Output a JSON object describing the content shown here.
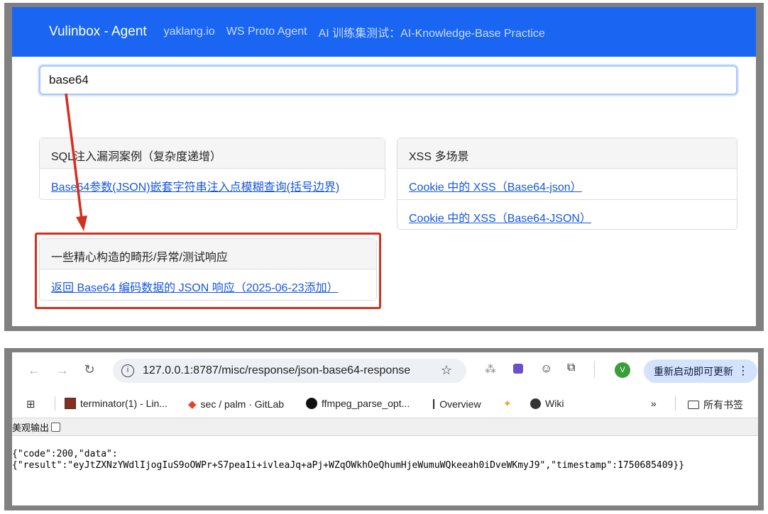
{
  "top": {
    "nav": {
      "brand": "Vulinbox - Agent",
      "links": [
        "yaklang.io",
        "WS Proto Agent",
        "AI 训练集测试：AI-Knowledge-Base Practice"
      ]
    },
    "search": {
      "value": "base64"
    },
    "cards": {
      "sql": {
        "header": "SQL注入漏洞案例（复杂度递增）",
        "items": [
          "Base64参数(JSON)嵌套字符串注入点模糊查询(括号边界)"
        ]
      },
      "xss": {
        "header": "XSS 多场景",
        "items": [
          "Cookie 中的 XSS（Base64-json）",
          "Cookie 中的 XSS（Base64-JSON）"
        ]
      },
      "weird": {
        "header": "一些精心构造的畸形/异常/测试响应",
        "items": [
          "返回 Base64 编码数据的 JSON 响应（2025-06-23添加）"
        ]
      }
    },
    "annotation_color": "#d3311f"
  },
  "browser": {
    "url": "127.0.0.1:8787/misc/response/json-base64-response",
    "update_label": "重新启动即可更新",
    "avatar_letter": "V",
    "bookmarks": [
      "terminator(1) - Lin...",
      "sec / palm · GitLab",
      "ffmpeg_parse_opt...",
      "Overview",
      "Wiki"
    ],
    "all_bookmarks": "所有书签",
    "viewer_label": "美观输出",
    "json_output": "{\"code\":200,\"data\":\n{\"result\":\"eyJtZXNzYWdlIjogIuS9oOWPr+S7pea1i+ivleaJq+aPj+WZqOWkhOeQhumHjeWumuWQkeeah0iDveWKmyJ9\",\"timestamp\":1750685409}}"
  }
}
